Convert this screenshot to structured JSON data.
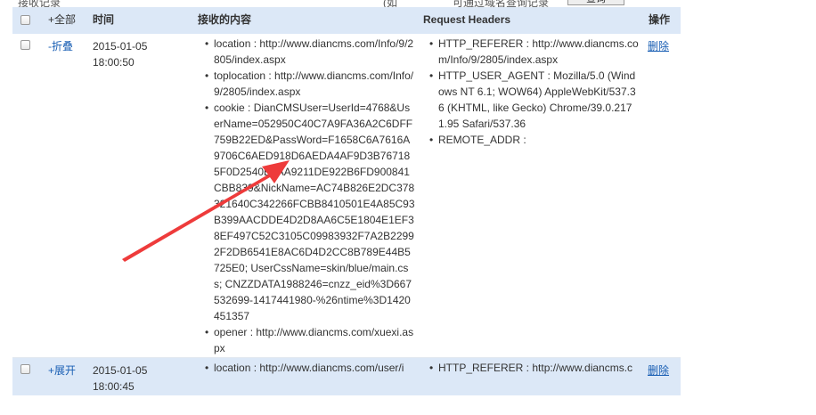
{
  "top_strip": {
    "left_text": "接收记录",
    "mid_text": "(如",
    "right_text": "可通过域名查询记录",
    "button_label": "查询"
  },
  "table": {
    "header": {
      "toggle_all": "+全部",
      "time": "时间",
      "content": "接收的内容",
      "request_headers": "Request Headers",
      "action": "操作"
    },
    "rows": [
      {
        "toggle": "-折叠",
        "date": "2015-01-05",
        "time": "18:00:50",
        "content": [
          "location : http://www.diancms.com/Info/9/2805/index.aspx",
          "toplocation : http://www.diancms.com/Info/9/2805/index.aspx",
          "cookie : DianCMSUser=UserId=4768&UserName=052950C40C7A9FA36A2C6DFF759B22ED&PassWord=F1658C6A7616A9706C6AED918D6AEDA4AF9D3B767185F0D2540B4AA9211DE922B6FD900841CBB839&NickName=AC74B826E2DC378321640C342266FCBB8410501E4A85C93B399AACDDE4D2D8AA6C5E1804E1EF38EF497C52C3105C09983932F7A2B22992F2DB6541E8AC6D4D2CC8B789E44B5725E0; UserCssName=skin/blue/main.css; CNZZDATA1988246=cnzz_eid%3D667532699-1417441980-%26ntime%3D1420451357",
          "opener : http://www.diancms.com/xuexi.aspx"
        ],
        "headers": [
          "HTTP_REFERER : http://www.diancms.com/Info/9/2805/index.aspx",
          "HTTP_USER_AGENT : Mozilla/5.0 (Windows NT 6.1; WOW64) AppleWebKit/537.36 (KHTML, like Gecko) Chrome/39.0.2171.95 Safari/537.36",
          "REMOTE_ADDR :"
        ],
        "action": "删除"
      },
      {
        "toggle": "+展开",
        "date": "2015-01-05",
        "time": "18:00:45",
        "content": [
          "location : http://www.diancms.com/user/i"
        ],
        "headers": [
          "HTTP_REFERER : http://www.diancms.c"
        ],
        "action": "删除"
      }
    ]
  },
  "annotation": {
    "arrow_color": "#ee3b3b"
  }
}
